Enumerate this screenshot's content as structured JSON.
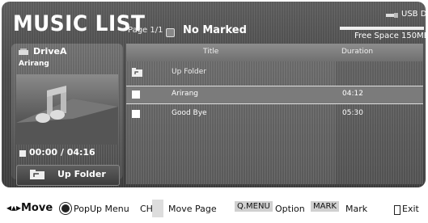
{
  "header": {
    "title": "MUSIC LIST",
    "page_info": "Page 1/1",
    "marked_status": "No Marked",
    "device_label": "USB Device",
    "free_space": "Free Space 150MB",
    "device_icon": "usb-icon",
    "free_space_level": 1.0
  },
  "preview": {
    "drive_label": "DriveA",
    "drive_icon": "drive-icon",
    "track_name": "Arirang",
    "time": "00:00 / 04:16",
    "stop_icon": "stop-icon",
    "up_folder_label": "Up Folder",
    "up_folder_icon": "up-folder-icon"
  },
  "list": {
    "columns": {
      "title": "Title",
      "duration": "Duration"
    },
    "rows": [
      {
        "name": "Up Folder",
        "duration": "",
        "type": "folder",
        "selected": false
      },
      {
        "name": "Arirang",
        "duration": "04:12",
        "type": "file",
        "selected": true
      },
      {
        "name": "Good Bye",
        "duration": "05:30",
        "type": "file",
        "selected": false
      }
    ]
  },
  "footer": {
    "move_icon": "four-way-arrow-icon",
    "move": "Move",
    "ok_icon": "ok-button-icon",
    "popup_menu": "PopUp Menu",
    "ch": "CH",
    "ch_icon": "ch-up-down-icon",
    "move_page": "Move Page",
    "qmenu": "Q.MENU",
    "option": "Option",
    "mark_key": "MARK",
    "mark": "Mark",
    "exit_icon": "exit-button-icon",
    "exit": "Exit"
  },
  "colors": {
    "panel": "#4a4a4a",
    "list_header": "#7d7d7d",
    "selected_row": "#7b7b7b",
    "text": "#ffffff"
  }
}
